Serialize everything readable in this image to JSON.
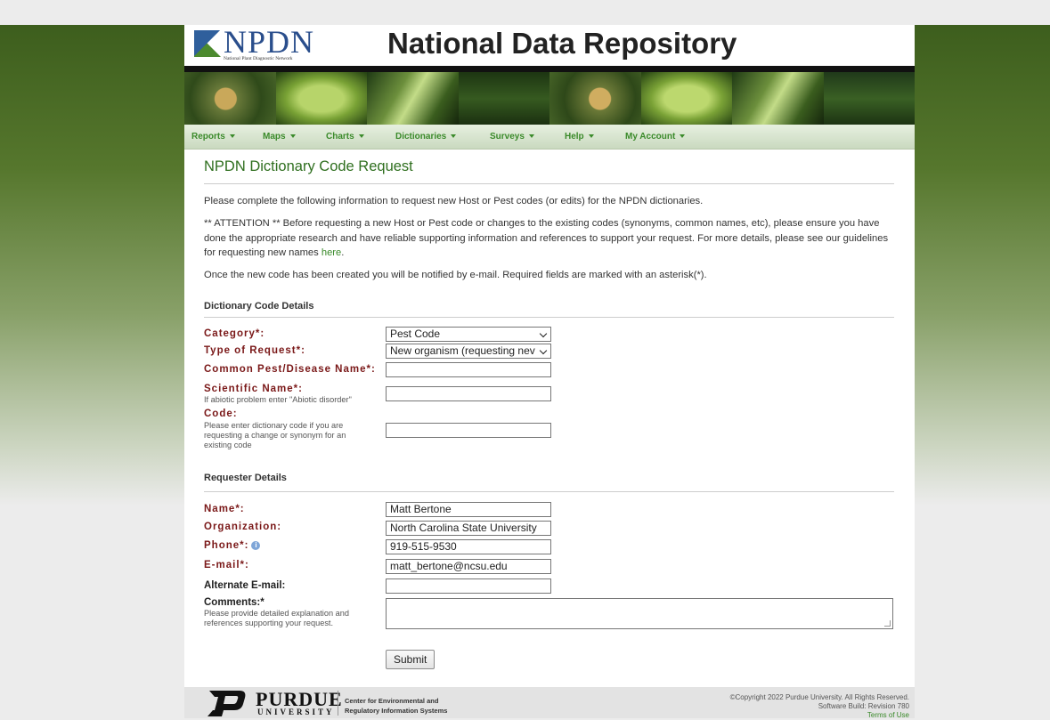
{
  "header": {
    "logo_text": "NPDN",
    "logo_sub": "National Plant Diagnostic Network",
    "site_title": "National Data Repository"
  },
  "nav": [
    "Reports",
    "Maps",
    "Charts",
    "Dictionaries",
    "Surveys",
    "Help",
    "My Account"
  ],
  "page": {
    "title": "NPDN Dictionary Code Request",
    "intro": "Please complete the following information to request new Host or Pest codes (or edits) for the NPDN dictionaries.",
    "attention_a": "** ATTENTION ** Before requesting a new Host or Pest code or changes to the existing codes (synonyms, common names, etc), please ensure you have done the appropriate research and have reliable supporting information and references to support your request. For more details, please see our guidelines for requesting new names ",
    "attention_link": "here",
    "attention_end": ".",
    "notify": "Once the new code has been created you will be notified by e-mail. Required fields are marked with an asterisk(*)."
  },
  "dictionary_section": {
    "title": "Dictionary Code Details",
    "category_label": "Category*:",
    "category_value": "Pest Code",
    "request_type_label": "Type of Request*:",
    "request_type_value": "New organism (requesting nev",
    "common_name_label": "Common Pest/Disease Name*:",
    "common_name_value": "",
    "scientific_name_label": "Scientific Name*:",
    "scientific_name_hint": "If abiotic problem enter \"Abiotic disorder\"",
    "scientific_name_value": "",
    "code_label": "Code:",
    "code_hint_1": "Please enter dictionary code if you are",
    "code_hint_2": "requesting a change or synonym for an",
    "code_hint_3": "existing code",
    "code_value": ""
  },
  "requester_section": {
    "title": "Requester Details",
    "name_label": "Name*:",
    "name_value": "Matt Bertone",
    "org_label": "Organization:",
    "org_value": "North Carolina State University",
    "phone_label": "Phone*:",
    "phone_value": "919-515-9530",
    "email_label": "E-mail*:",
    "email_value": "matt_bertone@ncsu.edu",
    "alt_email_label": "Alternate E-mail:",
    "alt_email_value": "",
    "comments_label": "Comments:*",
    "comments_hint_1": "Please provide detailed explanation and",
    "comments_hint_2": "references supporting your request."
  },
  "submit_label": "Submit",
  "footer": {
    "purdue": "PURDUE",
    "university": "UNIVERSITY",
    "center_1": "Center for Environmental and",
    "center_2": "Regulatory Information Systems",
    "copyright": "©Copyright 2022 Purdue University. All Rights Reserved.",
    "build": "Software Build: Revision 780",
    "terms": "Terms of Use"
  }
}
